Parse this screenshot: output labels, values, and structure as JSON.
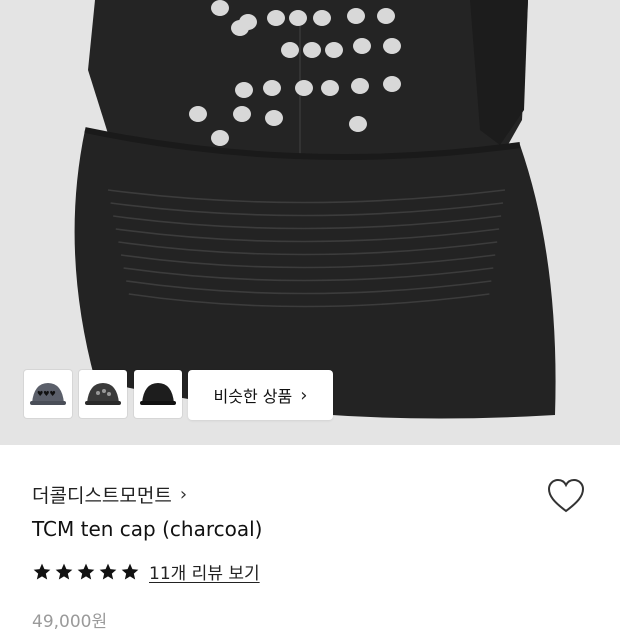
{
  "product_image": {
    "icon": "cap-product-photo",
    "colors": {
      "background": "#e4e4e4",
      "cap": "#222222",
      "embroidery": "#d8d8d8"
    }
  },
  "thumbnails": [
    {
      "name": "cap-thumbnail-gray-hearts",
      "color": "#5b5f6a"
    },
    {
      "name": "cap-thumbnail-dark-stones",
      "color": "#3a3a3a"
    },
    {
      "name": "cap-thumbnail-black",
      "color": "#1d1d1d"
    }
  ],
  "similar_button": {
    "label": "비슷한 상품",
    "icon": "chevron-right-icon"
  },
  "brand": {
    "label": "더콜디스트모먼트",
    "icon": "chevron-right-icon"
  },
  "wishlist": {
    "icon": "heart-outline-icon"
  },
  "product": {
    "name": "TCM ten cap (charcoal)",
    "price": "49,000원"
  },
  "rating": {
    "stars": 5,
    "max": 5,
    "review_link": "11개 리뷰 보기",
    "star_color": "#111111"
  }
}
